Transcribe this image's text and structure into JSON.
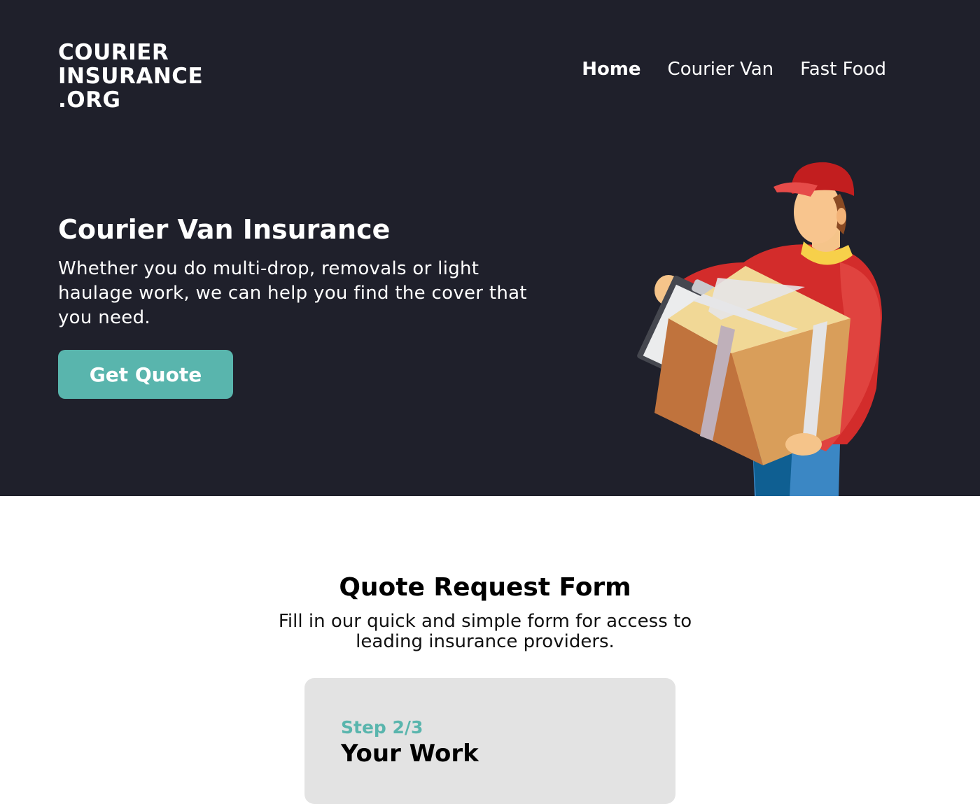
{
  "logo": {
    "line1": "COURIER",
    "line2": "INSURANCE",
    "line3": ".ORG"
  },
  "nav": {
    "items": [
      {
        "label": "Home",
        "active": true
      },
      {
        "label": "Courier Van",
        "active": false
      },
      {
        "label": "Fast Food",
        "active": false
      }
    ]
  },
  "hero": {
    "title": "Courier Van Insurance",
    "subtitle": "Whether you do multi-drop, removals or light haulage work, we can help you find the cover that you need.",
    "cta_label": "Get Quote",
    "illustration_icon": "courier-with-parcel-illustration"
  },
  "quote_section": {
    "title": "Quote Request Form",
    "subtitle": "Fill in our quick and simple form for access to leading insurance providers.",
    "step_label": "Step 2/3",
    "step_title": "Your Work"
  },
  "colors": {
    "hero_bg": "#1f202b",
    "accent": "#59b5ad",
    "card_bg": "#e3e3e3"
  }
}
